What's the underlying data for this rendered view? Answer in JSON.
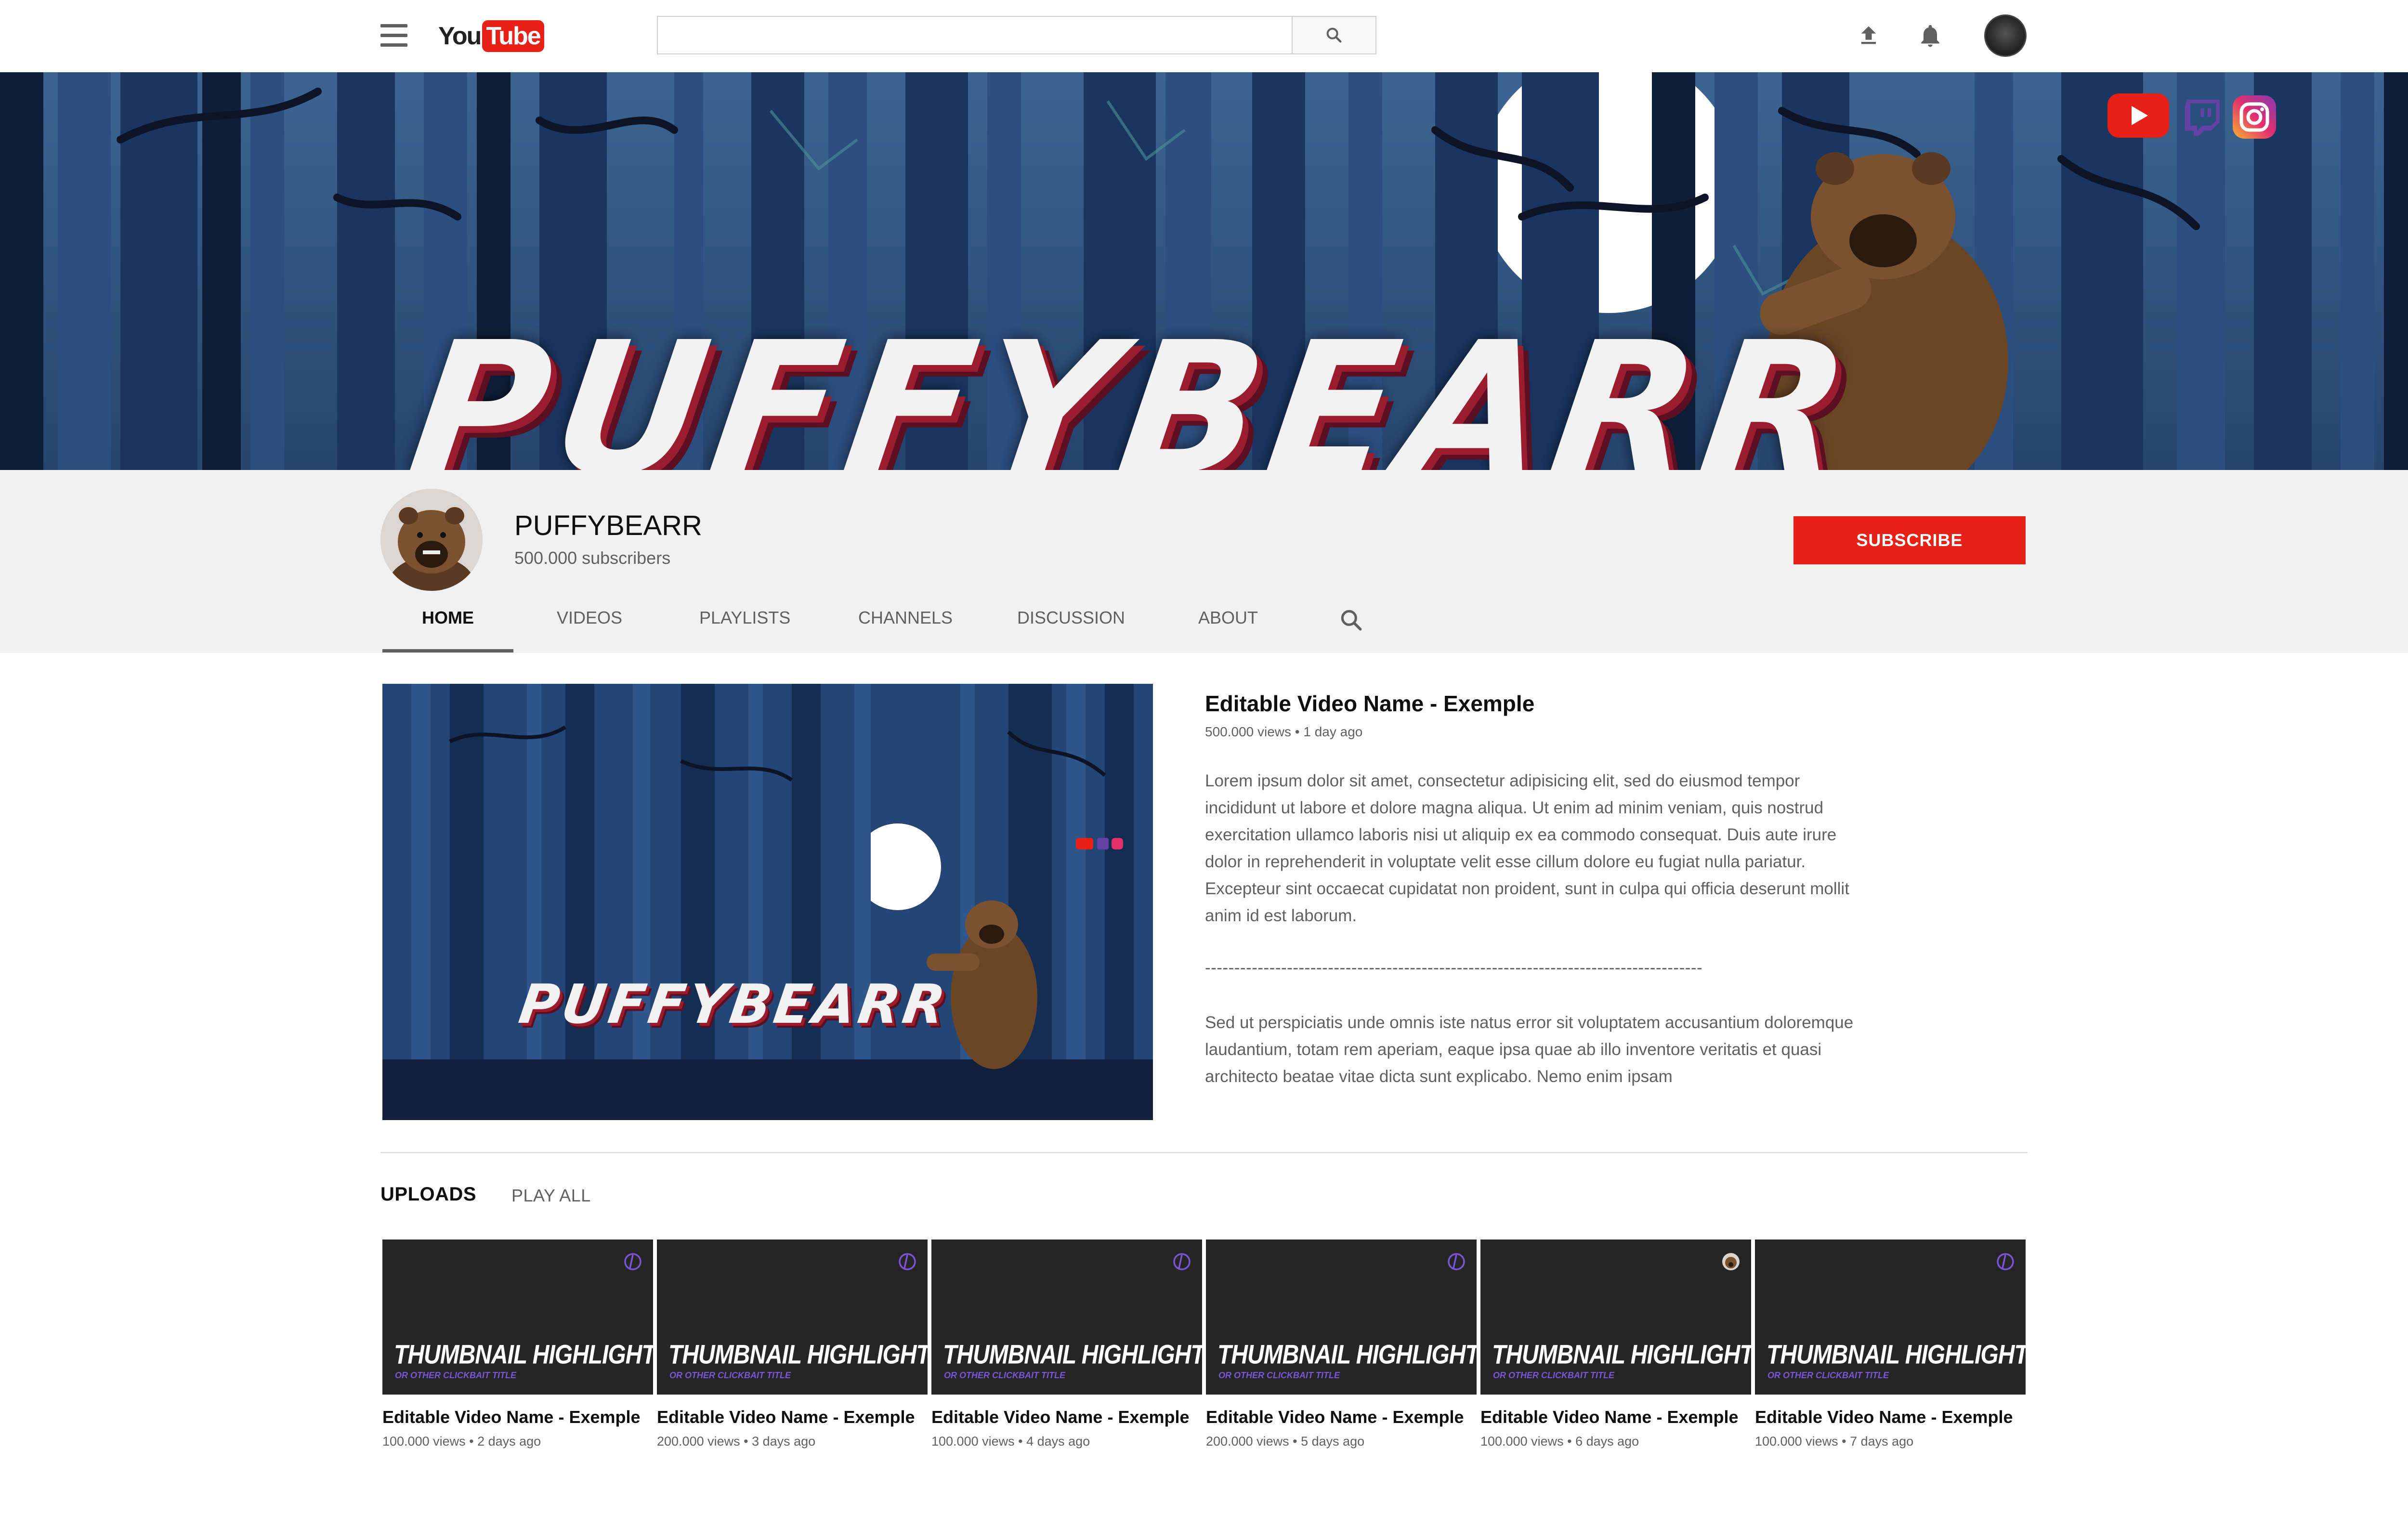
{
  "header": {
    "logo": {
      "you": "You",
      "tube": "Tube"
    },
    "search": {
      "value": "",
      "placeholder": ""
    }
  },
  "banner": {
    "title": "PUFFYBEARR",
    "social_icons": [
      "youtube-icon",
      "twitch-icon",
      "instagram-icon"
    ]
  },
  "channel": {
    "name": "PUFFYBEARR",
    "subscribers": "500.000 subscribers",
    "subscribe_label": "SUBSCRIBE",
    "tabs": [
      {
        "label": "HOME"
      },
      {
        "label": "VIDEOS"
      },
      {
        "label": "PLAYLISTS"
      },
      {
        "label": "CHANNELS"
      },
      {
        "label": "DISCUSSION"
      },
      {
        "label": "ABOUT"
      }
    ],
    "active_tab": "HOME"
  },
  "featured": {
    "thumb_title": "PUFFYBEARR",
    "title": "Editable Video Name - Exemple",
    "meta": "500.000 views • 1 day ago",
    "description": "Lorem ipsum dolor sit amet, consectetur adipisicing elit, sed do eiusmod tempor incididunt ut labore et dolore magna aliqua. Ut enim ad minim veniam, quis nostrud exercitation ullamco laboris nisi ut aliquip ex ea commodo consequat. Duis aute irure dolor in reprehenderit in voluptate velit esse cillum dolore eu fugiat nulla pariatur. Excepteur sint occaecat cupidatat non proident, sunt in culpa qui officia deserunt mollit anim id est laborum.",
    "divider": "-------------------------------------------------------------------------------------",
    "description2": "Sed ut perspiciatis unde omnis iste natus error sit voluptatem accusantium doloremque laudantium, totam rem aperiam, eaque ipsa quae ab illo inventore veritatis et quasi architecto beatae vitae dicta sunt explicabo. Nemo enim ipsam"
  },
  "uploads": {
    "heading": "UPLOADS",
    "play_all": "PLAY ALL",
    "videos": [
      {
        "thumb_text": "THUMBNAIL HIGHLIGHT",
        "thumb_sub": "OR OTHER CLICKBAIT TITLE",
        "title": "Editable Video Name - Exemple",
        "meta": "100.000 views • 2 days ago",
        "icon": "logo-mark-icon"
      },
      {
        "thumb_text": "THUMBNAIL HIGHLIGHT",
        "thumb_sub": "OR OTHER CLICKBAIT TITLE",
        "title": "Editable Video Name - Exemple",
        "meta": "200.000 views • 3 days ago",
        "icon": "logo-mark-icon"
      },
      {
        "thumb_text": "THUMBNAIL HIGHLIGHT",
        "thumb_sub": "OR OTHER CLICKBAIT TITLE",
        "title": "Editable Video Name - Exemple",
        "meta": "100.000 views • 4 days ago",
        "icon": "logo-mark-icon"
      },
      {
        "thumb_text": "THUMBNAIL HIGHLIGHT",
        "thumb_sub": "OR OTHER CLICKBAIT TITLE",
        "title": "Editable Video Name - Exemple",
        "meta": "200.000 views • 5 days ago",
        "icon": "logo-mark-icon"
      },
      {
        "thumb_text": "THUMBNAIL HIGHLIGHT",
        "thumb_sub": "OR OTHER CLICKBAIT TITLE",
        "title": "Editable Video Name - Exemple",
        "meta": "100.000 views • 6 days ago",
        "icon": "bear-avatar-icon"
      },
      {
        "thumb_text": "THUMBNAIL HIGHLIGHT",
        "thumb_sub": "OR OTHER CLICKBAIT TITLE",
        "title": "Editable Video Name - Exemple",
        "meta": "100.000 views • 7 days ago",
        "icon": "logo-mark-icon"
      }
    ]
  },
  "colors": {
    "brand_red": "#e62117",
    "banner_blue": "#2b4f7c",
    "twitch_purple": "#6441a5",
    "thumb_dark": "#252525"
  }
}
